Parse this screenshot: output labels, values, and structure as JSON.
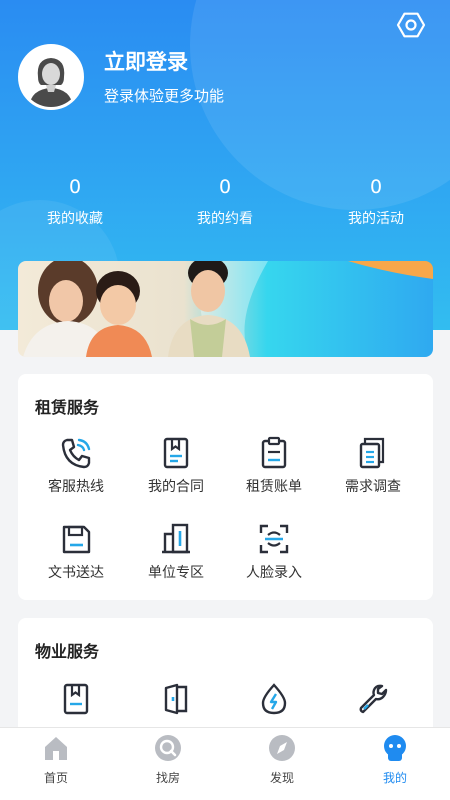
{
  "profile": {
    "title": "立即登录",
    "subtitle": "登录体验更多功能"
  },
  "stats": [
    {
      "value": "0",
      "label": "我的收藏"
    },
    {
      "value": "0",
      "label": "我的约看"
    },
    {
      "value": "0",
      "label": "我的活动"
    }
  ],
  "rental": {
    "title": "租赁服务",
    "items": [
      {
        "label": "客服热线",
        "icon": "phone-icon"
      },
      {
        "label": "我的合同",
        "icon": "contract-icon"
      },
      {
        "label": "租赁账单",
        "icon": "clipboard-icon"
      },
      {
        "label": "需求调查",
        "icon": "survey-icon"
      },
      {
        "label": "文书送达",
        "icon": "document-delivery-icon"
      },
      {
        "label": "单位专区",
        "icon": "building-icon"
      },
      {
        "label": "人脸录入",
        "icon": "face-scan-icon"
      }
    ]
  },
  "property": {
    "title": "物业服务",
    "items": [
      {
        "icon": "bookmark-icon"
      },
      {
        "icon": "door-icon"
      },
      {
        "icon": "utility-drop-icon"
      },
      {
        "icon": "wrench-icon"
      }
    ]
  },
  "tabbar": {
    "items": [
      {
        "label": "首页",
        "icon": "home-icon"
      },
      {
        "label": "找房",
        "icon": "search-house-icon"
      },
      {
        "label": "发现",
        "icon": "compass-icon"
      },
      {
        "label": "我的",
        "icon": "profile-icon"
      }
    ],
    "active_index": 3
  },
  "colors": {
    "header_blue": "#2a8cf2",
    "accent": "#1f8bf0",
    "icon_dark": "#2b2f3a",
    "icon_blue": "#25a7e8"
  }
}
